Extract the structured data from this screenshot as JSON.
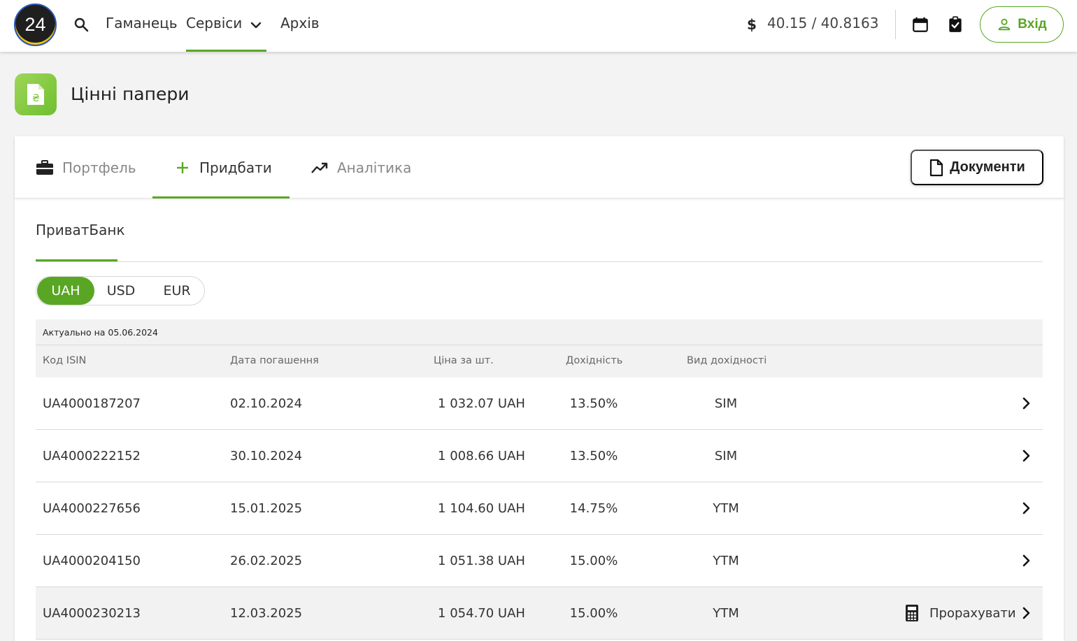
{
  "header": {
    "logo_text": "24",
    "nav": {
      "wallet": "Гаманець",
      "services": "Сервіси",
      "archive": "Архів"
    },
    "rate": "40.15 / 40.8163",
    "login_label": "Вхід"
  },
  "page": {
    "title": "Цінні папери"
  },
  "tabs": {
    "portfolio": "Портфель",
    "buy": "Придбати",
    "analytics": "Аналітика",
    "documents": "Документи"
  },
  "bank_tab": "ПриватБанк",
  "currencies": {
    "uah": "UAH",
    "usd": "USD",
    "eur": "EUR",
    "selected": "UAH"
  },
  "table": {
    "actual_note": "Актуально на 05.06.2024",
    "headers": {
      "isin": "Код ISIN",
      "maturity": "Дата погашення",
      "price": "Ціна за шт.",
      "yield": "Дохідність",
      "yield_type": "Вид дохідності"
    },
    "rows": [
      {
        "isin": "UA4000187207",
        "maturity": "02.10.2024",
        "price": "1 032.07 UAH",
        "yield": "13.50%",
        "yield_type": "SIM"
      },
      {
        "isin": "UA4000222152",
        "maturity": "30.10.2024",
        "price": "1 008.66 UAH",
        "yield": "13.50%",
        "yield_type": "SIM"
      },
      {
        "isin": "UA4000227656",
        "maturity": "15.01.2025",
        "price": "1 104.60 UAH",
        "yield": "14.75%",
        "yield_type": "YTM"
      },
      {
        "isin": "UA4000204150",
        "maturity": "26.02.2025",
        "price": "1 051.38 UAH",
        "yield": "15.00%",
        "yield_type": "YTM"
      },
      {
        "isin": "UA4000230213",
        "maturity": "12.03.2025",
        "price": "1 054.70 UAH",
        "yield": "15.00%",
        "yield_type": "YTM"
      }
    ],
    "calculate_label": "Прорахувати"
  },
  "colors": {
    "accent": "#59a624",
    "background": "#f3f3f3"
  }
}
